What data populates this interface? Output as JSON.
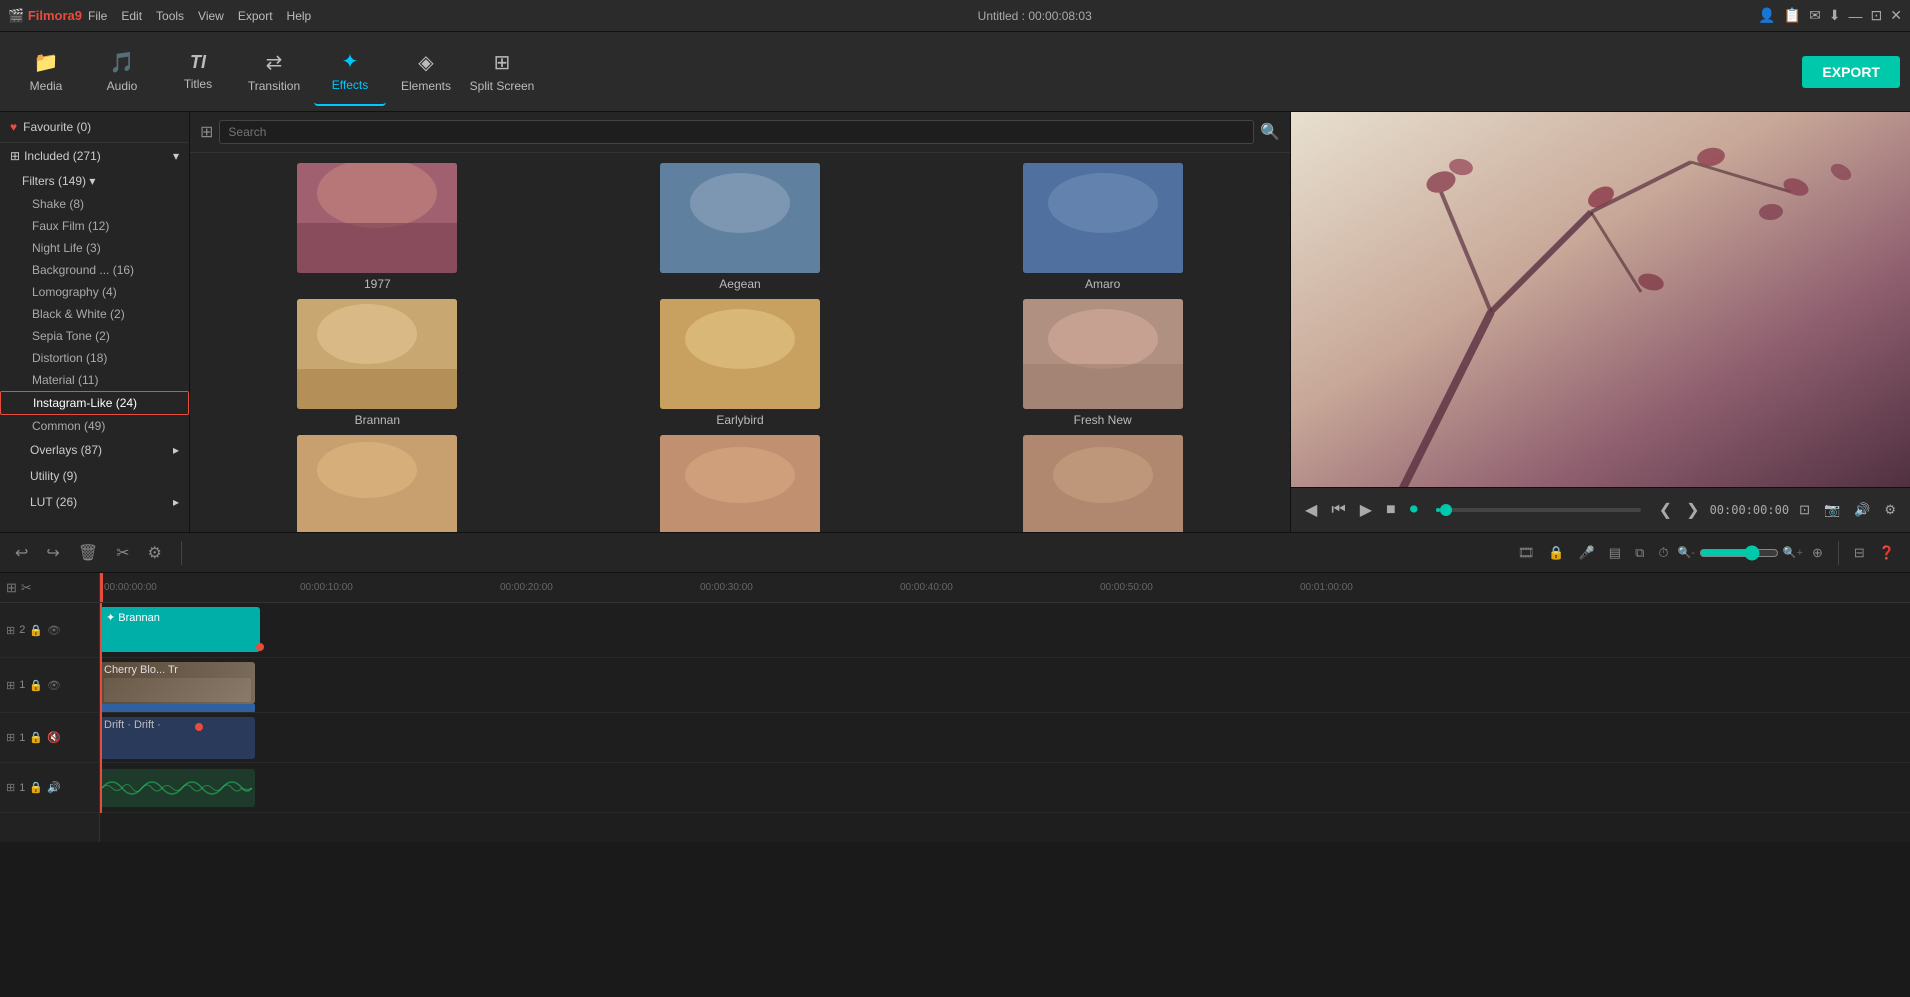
{
  "app": {
    "name": "Filmora9",
    "title": "Untitled : 00:00:08:03",
    "version": "9"
  },
  "titlebar": {
    "menus": [
      "File",
      "Edit",
      "Tools",
      "View",
      "Export",
      "Help"
    ],
    "window_controls": [
      "minimize",
      "maximize",
      "restore",
      "close"
    ]
  },
  "toolbar": {
    "items": [
      {
        "id": "media",
        "label": "Media",
        "icon": "📁"
      },
      {
        "id": "audio",
        "label": "Audio",
        "icon": "🎵"
      },
      {
        "id": "titles",
        "label": "Titles",
        "icon": "T"
      },
      {
        "id": "transition",
        "label": "Transition",
        "icon": "⇄"
      },
      {
        "id": "effects",
        "label": "Effects",
        "icon": "✦",
        "active": true
      },
      {
        "id": "elements",
        "label": "Elements",
        "icon": "◈"
      },
      {
        "id": "split_screen",
        "label": "Split Screen",
        "icon": "⊞"
      }
    ],
    "export_label": "EXPORT"
  },
  "sidebar": {
    "favourite": {
      "label": "Favourite (0)",
      "count": 0
    },
    "sections": [
      {
        "label": "Included (271)",
        "count": 271,
        "expanded": true,
        "subsections": [
          {
            "label": "Filters (149)",
            "count": 149,
            "expanded": true,
            "items": [
              {
                "label": "Shake (8)",
                "count": 8
              },
              {
                "label": "Faux Film (12)",
                "count": 12
              },
              {
                "label": "Night Life (3)",
                "count": 3
              },
              {
                "label": "Background ... (16)",
                "count": 16
              },
              {
                "label": "Lomography (4)",
                "count": 4
              },
              {
                "label": "Black & White (2)",
                "count": 2
              },
              {
                "label": "Sepia Tone (2)",
                "count": 2
              },
              {
                "label": "Distortion (18)",
                "count": 18
              },
              {
                "label": "Material (11)",
                "count": 11
              },
              {
                "label": "Instagram-Like (24)",
                "count": 24,
                "active": true,
                "highlighted": true
              },
              {
                "label": "Common (49)",
                "count": 49
              }
            ]
          },
          {
            "label": "Overlays (87)",
            "count": 87
          },
          {
            "label": "Utility (9)",
            "count": 9
          },
          {
            "label": "LUT (26)",
            "count": 26
          }
        ]
      }
    ]
  },
  "effects": {
    "search_placeholder": "Search",
    "items": [
      {
        "id": "yr1977",
        "label": "1977",
        "thumb_class": "yr1977"
      },
      {
        "id": "aegean",
        "label": "Aegean",
        "thumb_class": "aegean"
      },
      {
        "id": "amaro",
        "label": "Amaro",
        "thumb_class": "amaro"
      },
      {
        "id": "brannan",
        "label": "Brannan",
        "thumb_class": "brannan"
      },
      {
        "id": "earlybird",
        "label": "Earlybird",
        "thumb_class": "earlybird"
      },
      {
        "id": "freshnew",
        "label": "Fresh New",
        "thumb_class": "freshnew"
      },
      {
        "id": "row3a",
        "label": "",
        "thumb_class": "row3a"
      },
      {
        "id": "row3b",
        "label": "",
        "thumb_class": "row3b"
      },
      {
        "id": "row3c",
        "label": "",
        "thumb_class": "row3c"
      }
    ]
  },
  "preview": {
    "timecode": "00:00:00:00"
  },
  "timeline": {
    "toolbar": {
      "undo_label": "↩",
      "redo_label": "↪",
      "delete_label": "🗑",
      "cut_label": "✂",
      "adjust_label": "⚙"
    },
    "ruler_marks": [
      "00:00:00:00",
      "00:00:10:00",
      "00:00:20:00",
      "00:00:30:00",
      "00:00:40:00",
      "00:00:50:00",
      "00:01:00:00",
      "00:01:00:00+"
    ],
    "tracks": [
      {
        "number": "2",
        "clips": [
          {
            "label": "Brannan",
            "class": "clip-brannan"
          }
        ]
      },
      {
        "number": "1",
        "clips": [
          {
            "label": "Cherry Blo... Tr",
            "class": "clip-cherry"
          },
          {
            "label": "",
            "class": "clip-blue"
          }
        ]
      },
      {
        "number": "1",
        "clips": [
          {
            "label": "Drift · Drift ·",
            "class": "clip-drift"
          }
        ]
      },
      {
        "number": "1",
        "clips": [
          {
            "label": "",
            "class": "clip-audio-wave"
          }
        ]
      }
    ]
  }
}
